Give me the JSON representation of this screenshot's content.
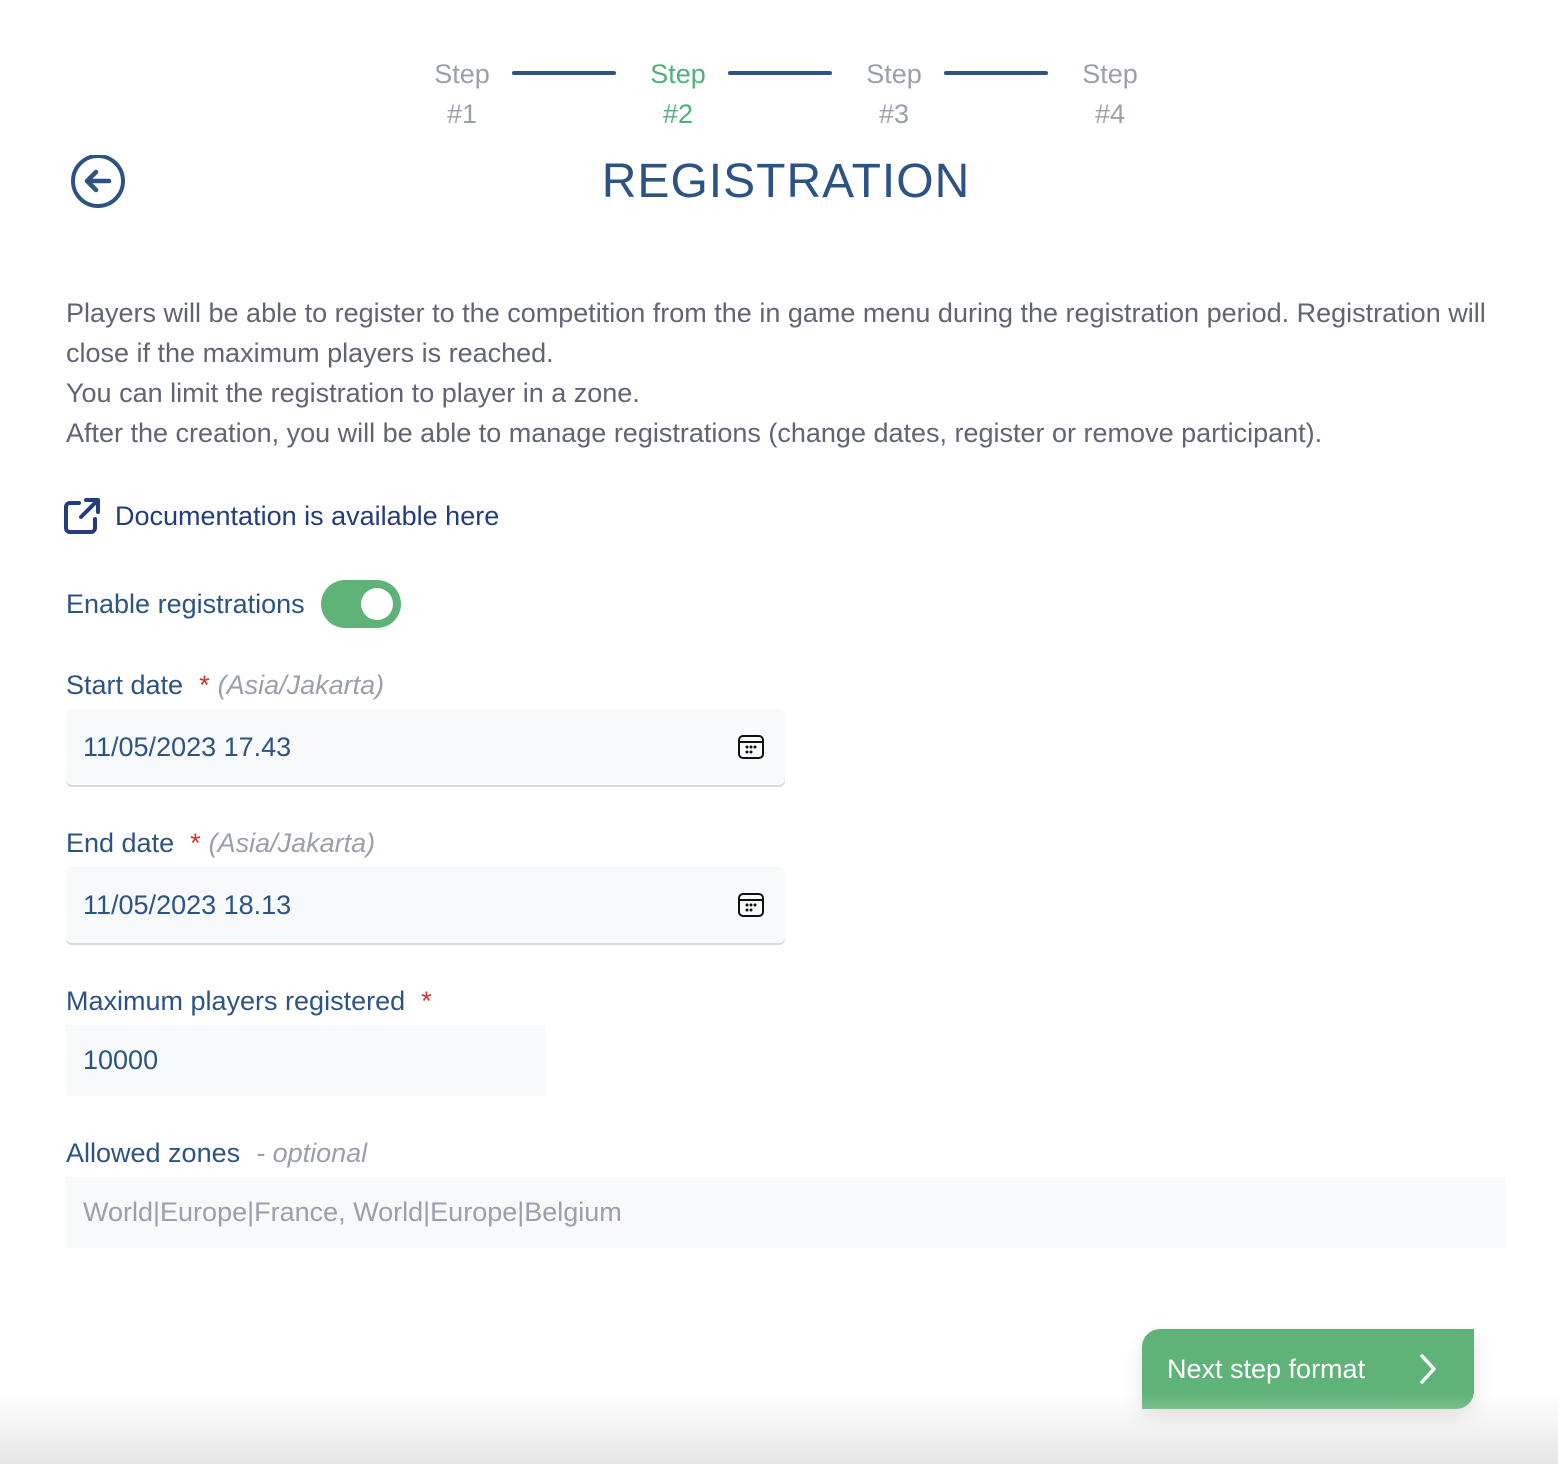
{
  "stepper": {
    "steps": [
      {
        "label": "Step",
        "number": "#1",
        "state": "inactive"
      },
      {
        "label": "Step",
        "number": "#2",
        "state": "active"
      },
      {
        "label": "Step",
        "number": "#3",
        "state": "inactive"
      },
      {
        "label": "Step",
        "number": "#4",
        "state": "inactive"
      }
    ]
  },
  "header": {
    "back_icon": "arrow-left-circle-icon",
    "title": "REGISTRATION"
  },
  "description": {
    "line1": "Players will be able to register to the competition from the in game menu during the registration period. Registration will close if the maximum players is reached.",
    "line2": "You can limit the registration to player in a zone.",
    "line3": "After the creation, you will be able to manage registrations (change dates, register or remove participant)."
  },
  "doc_link": {
    "icon": "external-link-icon",
    "label": "Documentation is available here"
  },
  "enable_registrations": {
    "label": "Enable registrations",
    "enabled": true
  },
  "form": {
    "start_date": {
      "label": "Start date",
      "required_mark": "*",
      "timezone": "(Asia/Jakarta)",
      "value": "11/05/2023 17.43",
      "icon": "calendar-icon"
    },
    "end_date": {
      "label": "End date",
      "required_mark": "*",
      "timezone": "(Asia/Jakarta)",
      "value": "11/05/2023 18.13",
      "icon": "calendar-icon"
    },
    "max_players": {
      "label": "Maximum players registered",
      "required_mark": "*",
      "value": "10000"
    },
    "allowed_zones": {
      "label": "Allowed zones",
      "optional_label": "- optional",
      "value": "",
      "placeholder": "World|Europe|France, World|Europe|Belgium"
    }
  },
  "next_button": {
    "label": "Next step format",
    "icon": "chevron-right-icon"
  },
  "colors": {
    "primary": "#2d5385",
    "accent_green": "#5fb378",
    "active_step": "#4fb07a",
    "muted": "#9aa0ab",
    "required": "#d0342c",
    "link": "#233c7c"
  }
}
